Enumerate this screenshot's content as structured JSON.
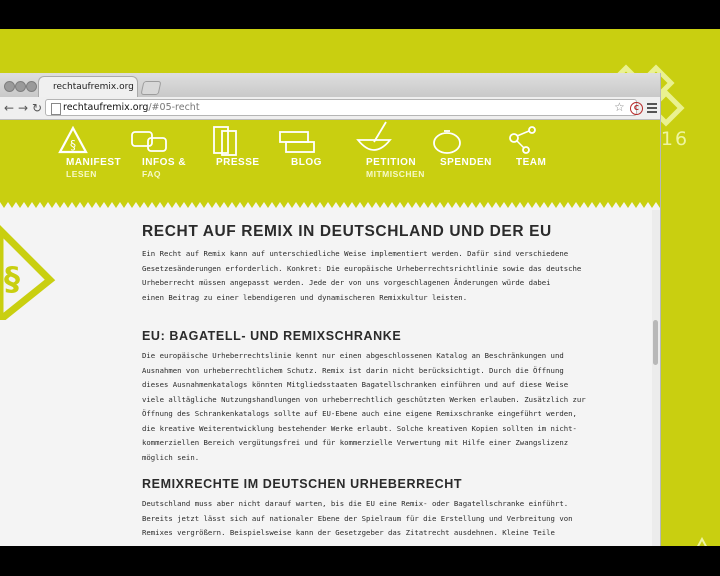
{
  "browser": {
    "tab_title": "rechtaufremix.org",
    "url_host": "rechtaufremix.org",
    "url_path": "/#05-recht",
    "back_icon": "arrow-left-icon",
    "forward_icon": "arrow-right-icon",
    "reload_icon": "reload-icon",
    "extension_label": "C"
  },
  "overlay": {
    "logo_text": "ooo16"
  },
  "site_nav": {
    "items": [
      {
        "label": "MANIFEST",
        "sub": "LESEN",
        "icon": "section-recycle-icon"
      },
      {
        "label": "INFOS &",
        "sub": "FAQ",
        "icon": "speech-bubbles-icon"
      },
      {
        "label": "PRESSE",
        "sub": "",
        "icon": "documents-icon"
      },
      {
        "label": "BLOG",
        "sub": "",
        "icon": "newspapers-icon"
      },
      {
        "label": "PETITION",
        "sub": "MITMISCHEN",
        "icon": "mixing-bowl-icon"
      },
      {
        "label": "SPENDEN",
        "sub": "",
        "icon": "piggy-bank-icon"
      },
      {
        "label": "TEAM",
        "sub": "",
        "icon": "network-icon"
      }
    ]
  },
  "article": {
    "title": "RECHT AUF REMIX IN DEUTSCHLAND UND DER EU",
    "intro_lines": [
      "Ein Recht auf Remix kann auf unterschiedliche Weise implementiert werden. Dafür sind verschiedene",
      "Gesetzesänderungen erforderlich. Konkret: Die europäische Urheberrechtsrichtlinie sowie das deutsche",
      "Urheberrecht müssen angepasst werden. Jede der von uns vorgeschlagenen Änderungen würde dabei",
      "einen Beitrag zu einer lebendigeren und dynamischeren Remixkultur leisten."
    ],
    "section1_heading": "EU: BAGATELL- UND REMIXSCHRANKE",
    "section1_lines": [
      "Die europäische Urheberrechtslinie kennt nur einen abgeschlossenen Katalog an Beschränkungen und",
      "Ausnahmen von urheberrechtlichem Schutz. Remix ist darin nicht berücksichtigt. Durch die Öffnung",
      "dieses Ausnahmenkatalogs könnten Mitgliedsstaaten Bagatellschranken einführen und auf diese Weise",
      "viele alltägliche Nutzungshandlungen von urheberrechtlich geschützten Werken erlauben. Zusätzlich zur",
      "Öffnung des Schrankenkatalogs sollte auf EU-Ebene auch eine eigene Remixschranke eingeführt werden,",
      "die kreative Weiterentwicklung bestehender Werke erlaubt. Solche kreativen Kopien sollten im nicht-",
      "kommerziellen Bereich vergütungsfrei und für kommerzielle Verwertung mit Hilfe einer Zwangslizenz",
      "möglich sein."
    ],
    "section2_heading": "REMIXRECHTE IM DEUTSCHEN URHEBERRECHT",
    "section2_lines": [
      "Deutschland muss aber nicht darauf warten, bis die EU eine Remix- oder Bagatellschranke einführt.",
      "Bereits jetzt lässt sich auf nationaler Ebene der Spielraum für die Erstellung und Verbreitung von",
      "Remixes vergrößern. Beispielsweise kann der Gesetzgeber das Zitatrecht ausdehnen. Kleine Teile"
    ]
  },
  "colors": {
    "brand_green": "#c9cf10",
    "page_bg": "#f4f4f4",
    "text": "#2a2a2a"
  }
}
